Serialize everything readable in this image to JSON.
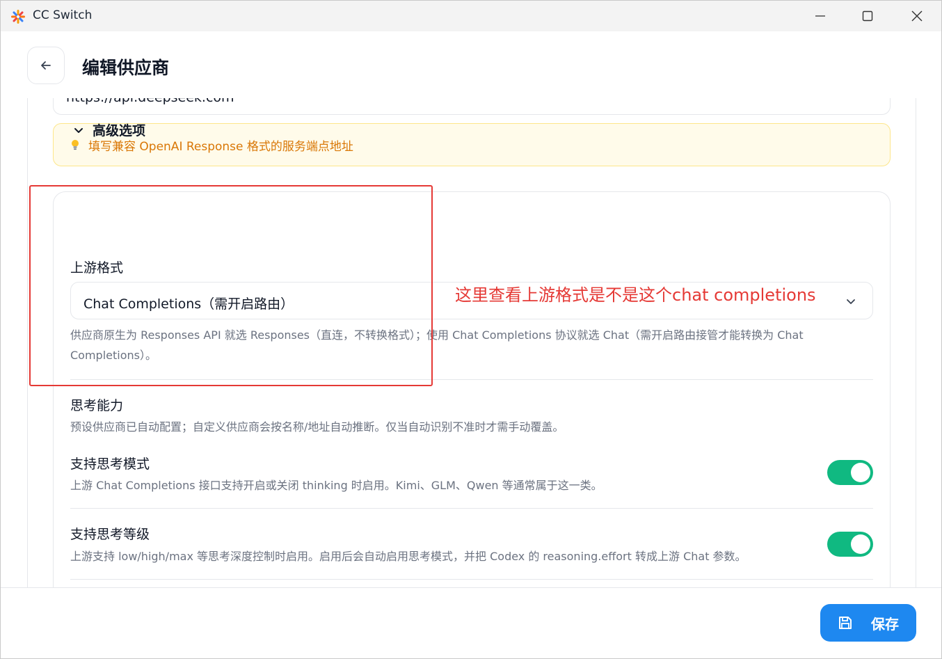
{
  "window": {
    "title": "CC Switch",
    "controls": {
      "minimize": "minimize-icon",
      "maximize": "maximize-icon",
      "close": "close-icon"
    }
  },
  "header": {
    "back_icon": "arrow-left-icon",
    "title": "编辑供应商"
  },
  "form": {
    "base_url_value": "https://api.deepseek.com",
    "hint": {
      "icon": "lightbulb-icon",
      "text": "填写兼容 OpenAI Response 格式的服务端点地址"
    },
    "advanced": {
      "title": "高级选项",
      "expanded": true,
      "upstream_format": {
        "label": "上游格式",
        "selected": "Chat Completions（需开启路由）",
        "description": "供应商原生为 Responses API 就选 Responses（直连，不转换格式）；使用 Chat Completions 协议就选 Chat（需开启路由接管才能转换为 Chat Completions）。"
      },
      "thinking": {
        "section_title": "思考能力",
        "section_desc": "预设供应商已自动配置；自定义供应商会按名称/地址自动推断。仅当自动识别不准时才需手动覆盖。",
        "mode": {
          "label": "支持思考模式",
          "desc": "上游 Chat Completions 接口支持开启或关闭 thinking 时启用。Kimi、GLM、Qwen 等通常属于这一类。",
          "enabled": true
        },
        "level": {
          "label": "支持思考等级",
          "desc": "上游支持 low/high/max 等思考深度控制时启用。启用后会自动启用思考模式，并把 Codex 的 reasoning.effort 转成上游 Chat 参数。",
          "enabled": true
        }
      }
    }
  },
  "annotation": {
    "text": "这里查看上游格式是不是这个chat completions",
    "color": "#e53935"
  },
  "footer": {
    "save_label": "保存",
    "save_icon": "save-icon"
  },
  "colors": {
    "accent": "#1e88f0",
    "toggle_on": "#10b981",
    "hint_bg": "#fffbea",
    "hint_text": "#d97706"
  }
}
